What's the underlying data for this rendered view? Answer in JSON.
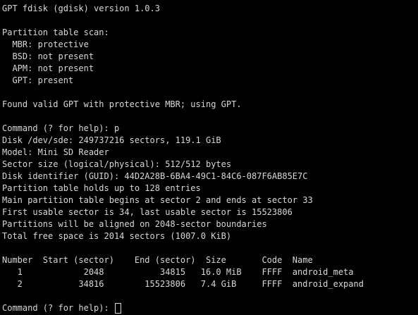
{
  "terminal": {
    "version_line": "GPT fdisk (gdisk) version 1.0.3",
    "scan": {
      "header": "Partition table scan:",
      "mbr": "  MBR: protective",
      "bsd": "  BSD: not present",
      "apm": "  APM: not present",
      "gpt": "  GPT: present"
    },
    "found_line": "Found valid GPT with protective MBR; using GPT.",
    "command_line": "Command (? for help): p",
    "disk_info": [
      "Disk /dev/sde: 249737216 sectors, 119.1 GiB",
      "Model: Mini SD Reader",
      "Sector size (logical/physical): 512/512 bytes",
      "Disk identifier (GUID): 44D2A28B-6BA4-49C1-84C6-087F6AB85E7C",
      "Partition table holds up to 128 entries",
      "Main partition table begins at sector 2 and ends at sector 33",
      "First usable sector is 34, last usable sector is 15523806",
      "Partitions will be aligned on 2048-sector boundaries",
      "Total free space is 2014 sectors (1007.0 KiB)"
    ],
    "table": {
      "header": "Number  Start (sector)    End (sector)  Size       Code  Name",
      "rows": [
        "   1            2048           34815   16.0 MiB    FFFF  android_meta",
        "   2           34816        15523806   7.4 GiB     FFFF  android_expand"
      ]
    },
    "prompt": "Command (? for help): "
  },
  "colors": {
    "background": "#000000",
    "foreground": "#d8d8d8"
  }
}
